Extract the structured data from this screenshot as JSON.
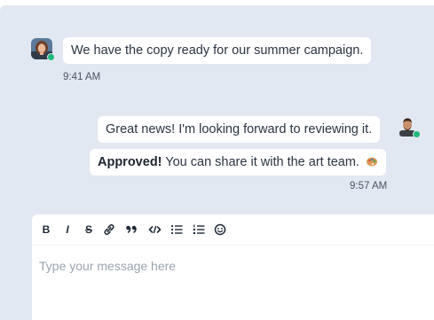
{
  "messages": [
    {
      "sender": "incoming",
      "text": "We have the copy ready for our summer campaign.",
      "time": "9:41 AM"
    },
    {
      "sender": "outgoing",
      "text": "Great news! I'm looking forward to reviewing it."
    },
    {
      "sender": "outgoing",
      "bold_prefix": "Approved!",
      "text": " You can share it with the art team.",
      "emoji_icon": "palette-icon",
      "time": "9:57 AM"
    }
  ],
  "composer": {
    "placeholder": "Type your message here",
    "toolbar": [
      {
        "name": "bold-button",
        "label": "B"
      },
      {
        "name": "italic-button",
        "label": "I"
      },
      {
        "name": "strikethrough-button",
        "label": "S"
      },
      {
        "name": "link-button",
        "icon": "link-icon"
      },
      {
        "name": "quote-button",
        "label": "99"
      },
      {
        "name": "code-button",
        "icon": "code-icon"
      },
      {
        "name": "bullet-list-button",
        "icon": "bullet-list-icon"
      },
      {
        "name": "numbered-list-button",
        "icon": "numbered-list-icon"
      },
      {
        "name": "emoji-button",
        "icon": "smiley-icon"
      }
    ]
  },
  "colors": {
    "background": "#e2e8f1",
    "bubble": "#ffffff",
    "online": "#1fb97a"
  }
}
